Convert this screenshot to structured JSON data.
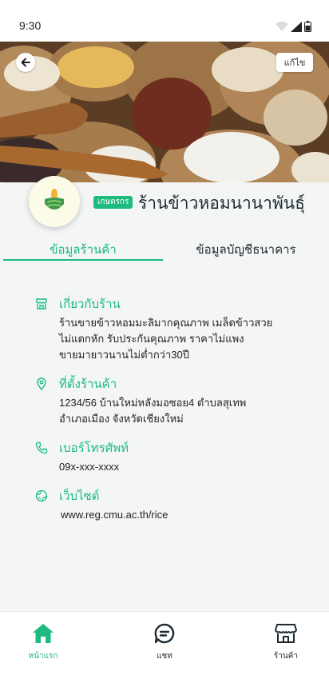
{
  "status_bar": {
    "time": "9:30"
  },
  "header": {
    "edit_label": "แก้ไข"
  },
  "store": {
    "badge": "เกษตรกร",
    "name": "ร้านข้าวหอมนานาพันธุ์"
  },
  "tabs": [
    {
      "label": "ข้อมูลร้านค้า",
      "active": true
    },
    {
      "label": "ข้อมูลบัญชีธนาคาร",
      "active": false
    }
  ],
  "info": {
    "about": {
      "title": "เกี่ยวกับร้าน",
      "lines": [
        "ร้านขายข้าวหอมมะลิมากคุณภาพ เมล็ดข้าวสวย",
        "ไม่แตกหัก  รับประกันคุณภาพ ราคาไม่แพง",
        "ขายมายาวนานไม่ต่ำกว่า30ปี"
      ]
    },
    "location": {
      "title": "ที่ตั้งร้านค้า",
      "lines": [
        "1234/56 บ้านใหม่หลังมอซอย4 ตำบลสุเทพ",
        "อำเภอเมือง จังหวัดเชียงใหม่"
      ]
    },
    "phone": {
      "title": "เบอร์โทรศัพท์",
      "value": "09x-xxx-xxxx"
    },
    "website": {
      "title": "เว็บไซต์",
      "value": "www.reg.cmu.ac.th/rice"
    }
  },
  "bottom_nav": {
    "home": "หน้าแรก",
    "chat": "แชท",
    "shop": "ร้านค้า"
  },
  "colors": {
    "accent": "#1dbb7e",
    "text_dark": "#1d2a32",
    "background": "#f3f6f5"
  },
  "icons": [
    "back-arrow-icon",
    "store-icon",
    "location-pin-icon",
    "phone-icon",
    "globe-icon",
    "home-icon",
    "chat-icon",
    "shop-icon",
    "rice-logo-icon",
    "wifi-icon",
    "signal-icon",
    "battery-icon"
  ]
}
